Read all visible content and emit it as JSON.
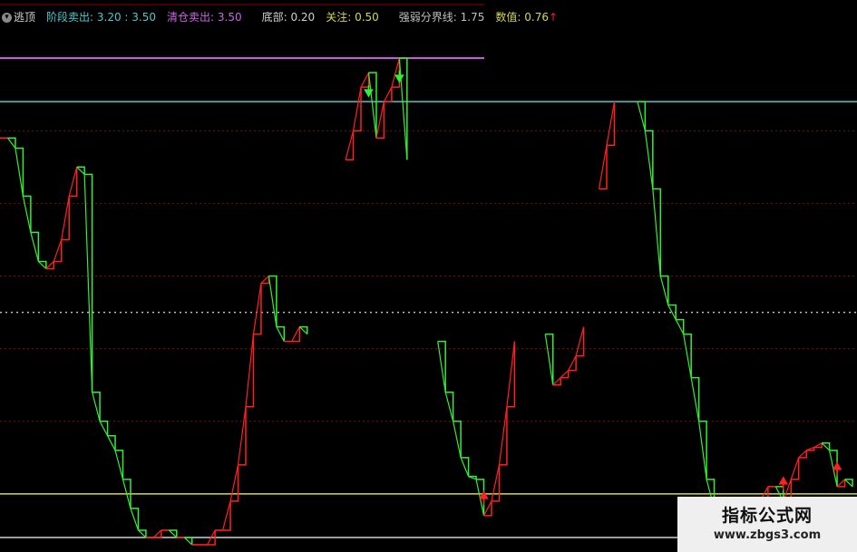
{
  "legend": {
    "title": "逃顶",
    "stage_sell_label": "阶段卖出:",
    "stage_sell_value": "3.20 : 3.50",
    "clear_sell_label": "清仓卖出:",
    "clear_sell_value": "3.50",
    "bottom_label": "底部:",
    "bottom_value": "0.20",
    "watch_label": "关注:",
    "watch_value": "0.50",
    "boundary_label": "强弱分界线:",
    "boundary_value": "1.75",
    "value_label": "数值:",
    "value_value": "0.76",
    "value_arrow": "↑"
  },
  "watermark": {
    "title": "指标公式网",
    "url": "www.zbgs3.com"
  },
  "colors": {
    "background": "#000000",
    "stage_sell": "#4ec8cc",
    "clear_sell": "#cc66e0",
    "bottom": "#d0d0d0",
    "watch": "#d4d84a",
    "boundary": "#c0c0c0",
    "value": "#d4d84a",
    "rising": "#ff2020",
    "falling": "#33ee33",
    "gridline": "#7a1010",
    "top_line": "#8a0000"
  },
  "chart_data": {
    "type": "line",
    "ylim": [
      0.1,
      3.9
    ],
    "grid": true,
    "levels": [
      {
        "name": "清仓卖出",
        "value": 3.5
      },
      {
        "name": "阶段卖出",
        "value": 3.2
      },
      {
        "name": "强弱分界线",
        "value": 1.75
      },
      {
        "name": "关注",
        "value": 0.5
      },
      {
        "name": "底部",
        "value": 0.2
      }
    ],
    "series": [
      {
        "values": [
          2.95,
          2.95,
          2.88,
          2.55,
          2.3,
          2.1,
          2.05,
          2.1,
          2.25,
          2.55,
          2.75,
          2.7,
          1.2,
          1.0,
          0.9,
          0.8,
          0.6,
          0.4,
          0.25,
          0.2,
          0.2,
          0.25,
          0.25,
          0.2,
          0.2,
          0.15,
          0.15,
          0.15,
          0.25,
          0.25,
          0.45,
          0.7,
          1.1,
          1.6,
          1.95,
          2.0,
          1.65,
          1.55,
          1.55,
          1.65,
          1.6,
          null,
          null,
          null,
          null,
          2.8,
          3.0,
          3.3,
          3.4,
          2.95,
          3.2,
          3.3,
          3.5,
          2.8,
          null,
          null,
          null,
          1.55,
          1.2,
          1.0,
          0.75,
          0.62,
          0.6,
          0.35,
          0.45,
          0.7,
          1.1,
          1.55,
          null,
          null,
          null,
          1.6,
          1.25,
          1.3,
          1.35,
          1.45,
          1.65,
          null,
          2.6,
          2.9,
          3.2,
          null,
          null,
          3.2,
          3.0,
          2.6,
          2.0,
          1.8,
          1.7,
          1.6,
          1.3,
          1.0,
          0.6,
          0.4,
          0.22,
          0.2,
          0.25,
          0.35,
          0.4,
          0.45,
          0.55,
          0.55,
          0.45,
          0.6,
          0.75,
          0.8,
          0.82,
          0.85,
          0.8,
          0.55,
          0.6,
          0.55
        ]
      }
    ]
  }
}
